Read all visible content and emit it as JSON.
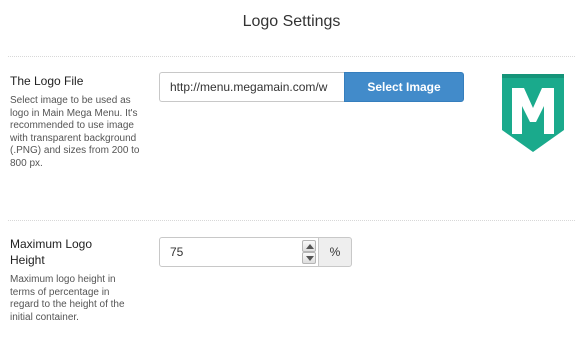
{
  "page": {
    "title": "Logo Settings"
  },
  "logo_file": {
    "label": "The Logo File",
    "description": "Select image to be used as logo in Main Mega Menu. It's recommended to use image with transparent background (.PNG) and sizes from 200 to 800 px.",
    "url_value": "http://menu.megamain.com/w",
    "select_button_label": "Select Image",
    "preview_icon": "megamain-m-logo",
    "preview_color": "#1aaa8c"
  },
  "max_height": {
    "label": "Maximum Logo Height",
    "description": "Maximum logo height in terms of percentage in regard to the height of the initial container.",
    "value": "75",
    "unit": "%",
    "up_icon": "caret-up-icon",
    "down_icon": "caret-down-icon"
  },
  "colors": {
    "accent": "#428bca",
    "logo": "#1aaa8c"
  }
}
